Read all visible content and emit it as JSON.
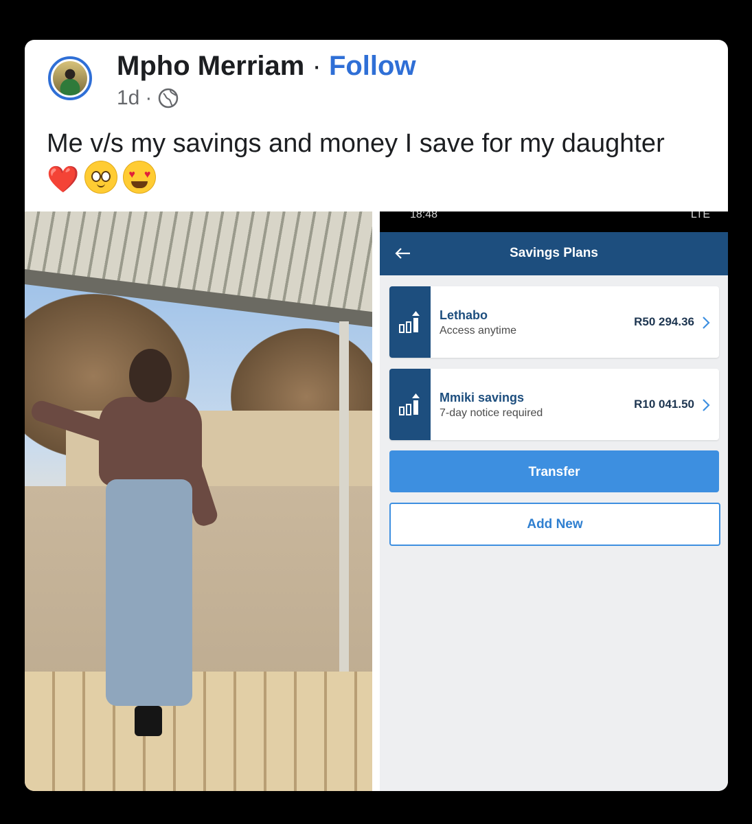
{
  "post": {
    "author_name": "Mpho Merriam",
    "separator": "·",
    "follow_label": "Follow",
    "time_ago": "1d",
    "time_separator": "·",
    "caption": "Me v/s my savings and money I save for my daughter",
    "caption_emojis": [
      "❤️",
      "🥺",
      "😍"
    ]
  },
  "bank_app": {
    "status_time": "18:48",
    "status_signal": "LTE",
    "header_title": "Savings Plans",
    "plans": [
      {
        "name": "Lethabo",
        "subtitle": "Access anytime",
        "amount": "R50 294.36"
      },
      {
        "name": "Mmiki savings",
        "subtitle": "7-day notice required",
        "amount": "R10 041.50"
      }
    ],
    "transfer_label": "Transfer",
    "add_new_label": "Add New"
  },
  "icons": [
    "globe-icon",
    "back-arrow-icon",
    "chart-up-icon",
    "chevron-right-icon",
    "heart-emoji",
    "pleading-face-emoji",
    "heart-eyes-emoji"
  ],
  "colors": {
    "follow_blue": "#2f6fd6",
    "bank_navy": "#1d4e7e",
    "bank_button_blue": "#3d8fe0",
    "background": "#000000"
  }
}
